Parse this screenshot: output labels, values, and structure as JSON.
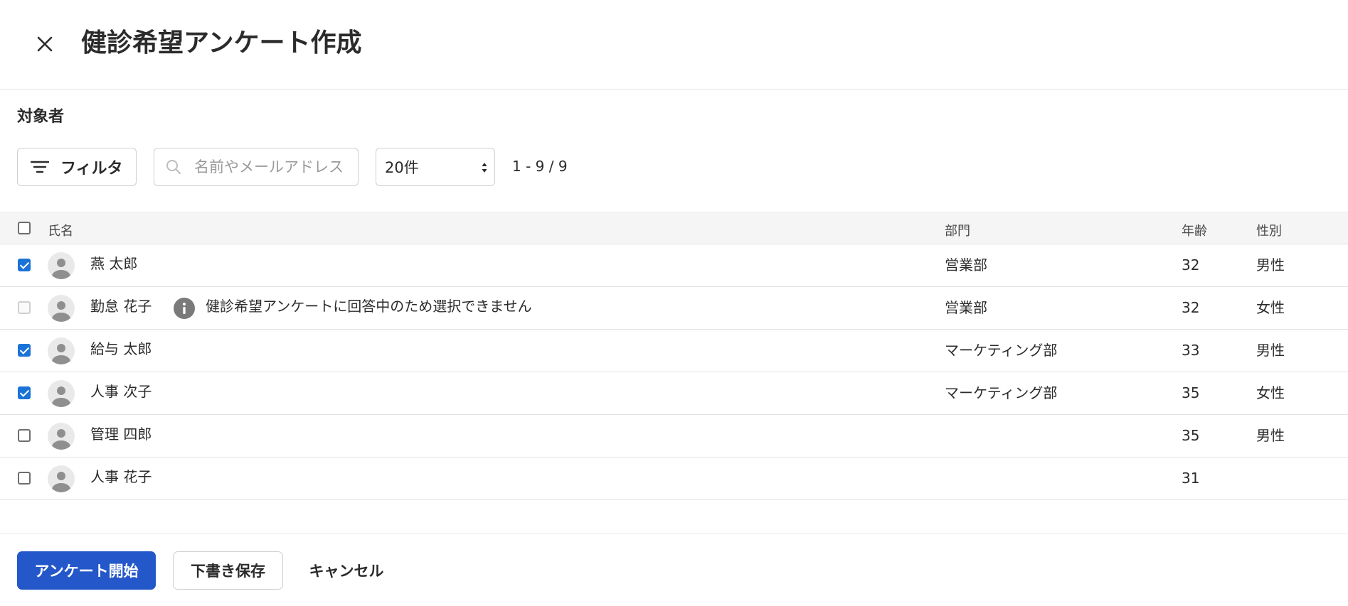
{
  "header": {
    "title": "健診希望アンケート作成",
    "close_icon": "close-icon"
  },
  "section": {
    "title": "対象者"
  },
  "toolbar": {
    "filter_label": "フィルタ",
    "filter_icon": "filter-icon",
    "search_placeholder": "名前やメールアドレス",
    "search_value": "",
    "search_icon": "search-icon",
    "per_page_value": "20件",
    "pager_text": "1 - 9 / 9"
  },
  "table": {
    "headers": {
      "name": "氏名",
      "dept": "部門",
      "age": "年齢",
      "gender": "性別"
    },
    "header_checked": false,
    "rows": [
      {
        "name": "燕 太郎",
        "dept": "営業部",
        "age": "32",
        "gender": "男性",
        "checked": true,
        "disabled": false,
        "note": ""
      },
      {
        "name": "勤怠 花子",
        "dept": "営業部",
        "age": "32",
        "gender": "女性",
        "checked": false,
        "disabled": true,
        "note": "健診希望アンケートに回答中のため選択できません"
      },
      {
        "name": "給与 太郎",
        "dept": "マーケティング部",
        "age": "33",
        "gender": "男性",
        "checked": true,
        "disabled": false,
        "note": ""
      },
      {
        "name": "人事 次子",
        "dept": "マーケティング部",
        "age": "35",
        "gender": "女性",
        "checked": true,
        "disabled": false,
        "note": ""
      },
      {
        "name": "管理 四郎",
        "dept": "",
        "age": "35",
        "gender": "男性",
        "checked": false,
        "disabled": false,
        "note": ""
      },
      {
        "name": "人事 花子",
        "dept": "",
        "age": "31",
        "gender": "",
        "checked": false,
        "disabled": false,
        "note": ""
      }
    ]
  },
  "footer": {
    "start_label": "アンケート開始",
    "draft_label": "下書き保存",
    "cancel_label": "キャンセル"
  },
  "colors": {
    "primary": "#2457c9",
    "checkbox_checked": "#1a73d6",
    "info_icon": "#7a7a7a"
  }
}
